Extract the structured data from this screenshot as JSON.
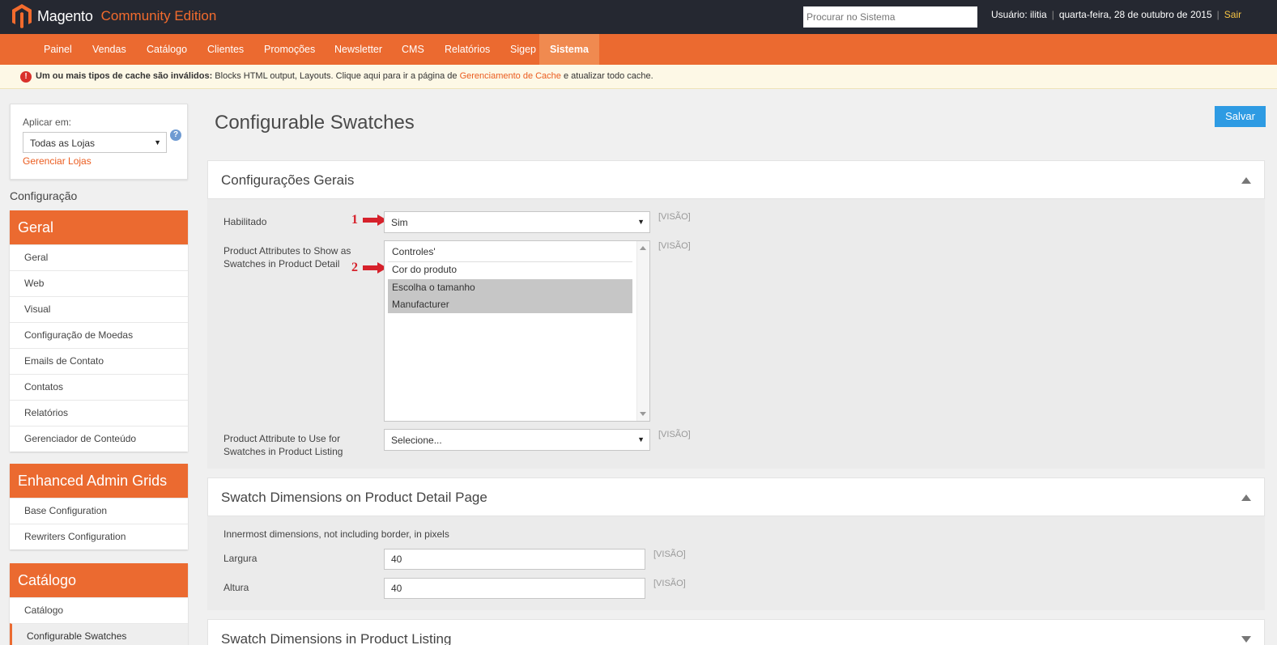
{
  "header": {
    "logo_text": "Magento",
    "edition": "Community Edition",
    "search_placeholder": "Procurar no Sistema",
    "user_label": "Usuário: ilitia",
    "date": "quarta-feira, 28 de outubro de 2015",
    "logout": "Sair",
    "separator": "|"
  },
  "nav": {
    "items": [
      "Painel",
      "Vendas",
      "Catálogo",
      "Clientes",
      "Promoções",
      "Newsletter",
      "CMS",
      "Relatórios",
      "Sigep",
      "Sistema"
    ],
    "active": "Sistema"
  },
  "notice": {
    "icon": "!",
    "bold": "Um ou mais tipos de cache são inválidos:",
    "text": " Blocks HTML output, Layouts. Clique aqui para ir a página de ",
    "link": "Gerenciamento de Cache",
    "text_after": " e atualizar todo cache."
  },
  "store_switcher": {
    "label": "Aplicar em:",
    "value": "Todas as Lojas",
    "manage_link": "Gerenciar Lojas",
    "help_icon": "?"
  },
  "sidebar": {
    "heading": "Configuração",
    "sections": [
      {
        "title": "Geral",
        "items": [
          "Geral",
          "Web",
          "Visual",
          "Configuração de Moedas",
          "Emails de Contato",
          "Contatos",
          "Relatórios",
          "Gerenciador de Conteúdo"
        ]
      },
      {
        "title": "Enhanced Admin Grids",
        "items": [
          "Base Configuration",
          "Rewriters Configuration"
        ]
      },
      {
        "title": "Catálogo",
        "items": [
          "Catálogo",
          "Configurable Swatches"
        ]
      }
    ]
  },
  "page": {
    "title": "Configurable Swatches",
    "save_button": "Salvar"
  },
  "general": {
    "title": "Configurações Gerais",
    "enabled_label": "Habilitado",
    "enabled_value": "Sim",
    "detail_attrs_label": "Product Attributes to Show as Swatches in Product Detail",
    "detail_attrs_options": [
      "Controles'",
      "Cor do produto",
      "Escolha o tamanho",
      "Manufacturer"
    ],
    "detail_attrs_selected": [
      "Escolha o tamanho",
      "Manufacturer"
    ],
    "listing_attr_label": "Product Attribute to Use for Swatches in Product Listing",
    "listing_attr_value": "Selecione...",
    "scope": "[VISÃO]"
  },
  "annotations": {
    "first": "1",
    "second": "2",
    "arrow_color": "#d6212b"
  },
  "detail_dims": {
    "title": "Swatch Dimensions on Product Detail Page",
    "help": "Innermost dimensions, not including border, in pixels",
    "width_label": "Largura",
    "width_value": "40",
    "height_label": "Altura",
    "height_value": "40",
    "scope": "[VISÃO]"
  },
  "listing_dims": {
    "title": "Swatch Dimensions in Product Listing"
  },
  "colors": {
    "accent": "#eb6a30",
    "header_bg": "#252831",
    "link": "#eb5c1f",
    "save": "#2e9be3"
  }
}
